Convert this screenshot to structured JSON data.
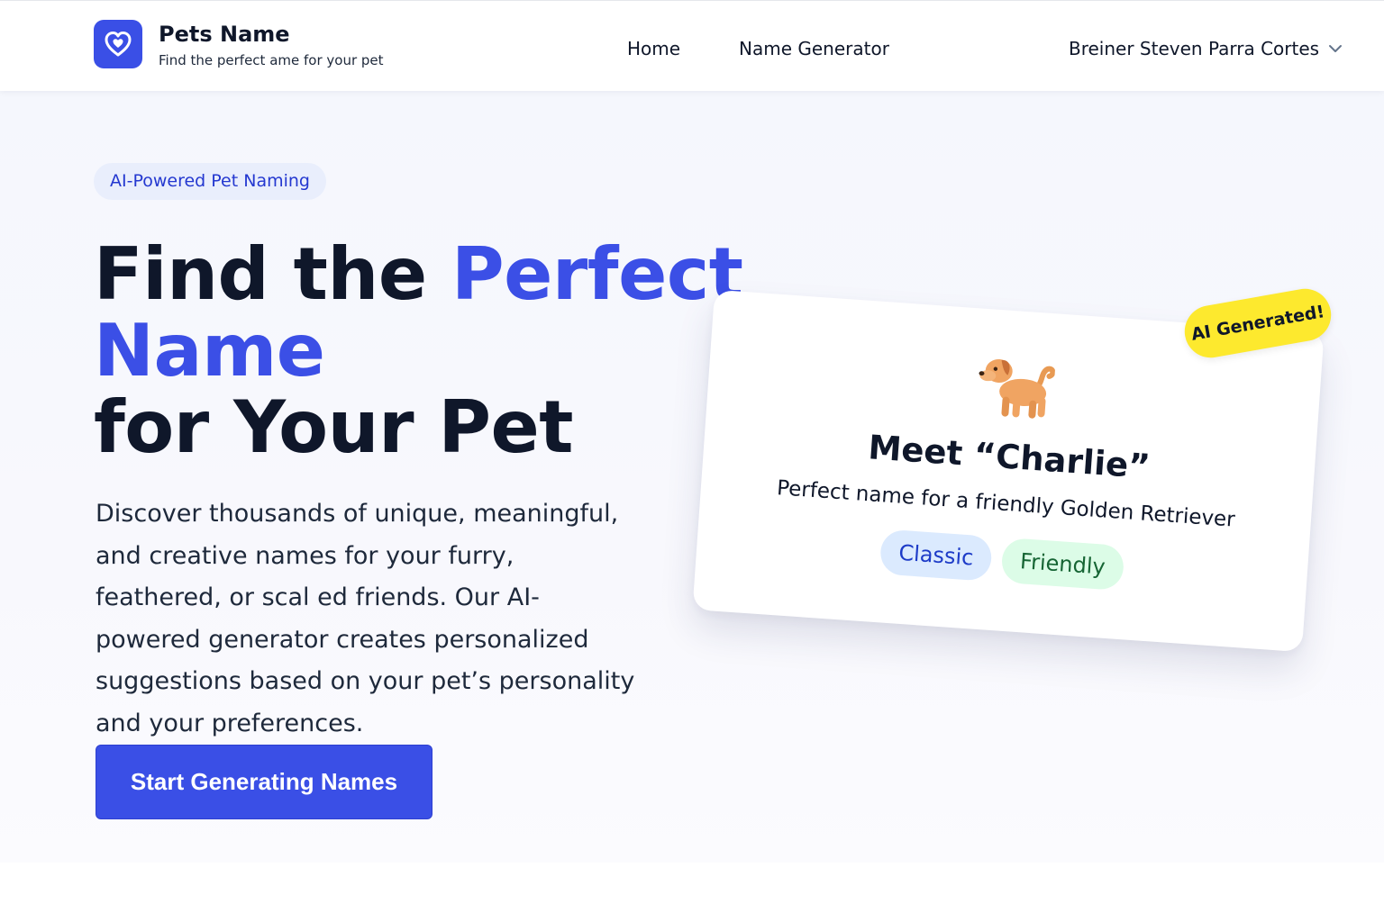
{
  "header": {
    "brand_title": "Pets Name",
    "brand_subtitle": "Find the perfect ame for your pet",
    "logo_icon": "heart-icon",
    "nav": [
      {
        "label": "Home"
      },
      {
        "label": "Name Generator"
      }
    ],
    "user_name": "Breiner Steven Parra Cortes",
    "user_menu_icon": "chevron-down-icon"
  },
  "hero": {
    "badge": "AI-Powered Pet Naming",
    "headline": {
      "part1": "Find the ",
      "part2": "Perfect",
      "part3": "Name",
      "part4": "for Your Pet"
    },
    "description": "Discover thousands of unique, meaningful, and creative names for your furry, feathered, or scal ed friends. Our AI-powered generator creates personalized suggestions based on your pet’s personality and your preferences.",
    "cta_label": "Start Generating Names"
  },
  "card": {
    "pet_icon": "dog-icon",
    "title": "Meet “Charlie”",
    "subtitle": "Perfect name for a friendly Golden Retriever",
    "tags": [
      "Classic",
      "Friendly"
    ],
    "ai_badge": "AI Generated!"
  },
  "colors": {
    "accent": "#3b4fe6",
    "badge_yellow": "#fde92e",
    "tag_classic_bg": "#dbeafe",
    "tag_friendly_bg": "#dcfce7"
  }
}
